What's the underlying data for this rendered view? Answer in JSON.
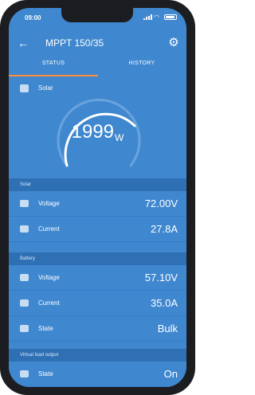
{
  "status_bar": {
    "time": "09:00"
  },
  "header": {
    "title": "MPPT 150/35"
  },
  "tabs": [
    {
      "label": "STATUS",
      "active": true
    },
    {
      "label": "HISTORY",
      "active": false
    }
  ],
  "gauge": {
    "label": "Solar",
    "value": "1999",
    "unit": "W"
  },
  "sections": [
    {
      "title": "Solar",
      "rows": [
        {
          "icon": "bolt-icon",
          "label": "Voltage",
          "value": "72.00V"
        },
        {
          "icon": "current-icon",
          "label": "Current",
          "value": "27.8A"
        }
      ]
    },
    {
      "title": "Battery",
      "rows": [
        {
          "icon": "bolt-icon",
          "label": "Voltage",
          "value": "57.10V"
        },
        {
          "icon": "current-icon",
          "label": "Current",
          "value": "35.0A"
        },
        {
          "icon": "state-icon",
          "label": "State",
          "value": "Bulk"
        }
      ]
    },
    {
      "title": "Virtual load output",
      "rows": [
        {
          "icon": "state-icon",
          "label": "State",
          "value": "On"
        }
      ]
    }
  ],
  "colors": {
    "background": "#3f87cf",
    "section_header": "#2f6fb4",
    "tab_indicator": "#ff8f3a"
  }
}
